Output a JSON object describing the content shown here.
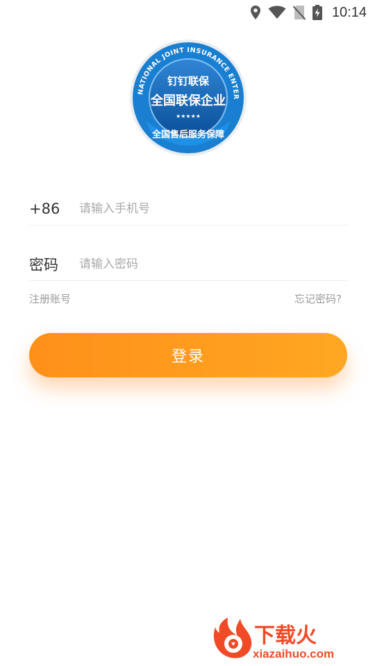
{
  "status_bar": {
    "time": "10:14",
    "icons": [
      "location-icon",
      "wifi-icon",
      "no-sim-icon",
      "battery-charging-icon"
    ]
  },
  "logo": {
    "ring_text": "NATIONAL JOINT INSURANCE ENTERPRISES",
    "brand": "钉钉联保",
    "title": "全国联保企业",
    "stars": "★★★★★",
    "bottom_text": "全国售后服务保障",
    "colors": {
      "outer": "#1a7fd0",
      "inner": "#0d5fae",
      "ribbon": "#1e90e6"
    }
  },
  "form": {
    "phone": {
      "prefix": "+86",
      "value": "",
      "placeholder": "请输入手机号"
    },
    "password": {
      "label": "密码",
      "value": "",
      "placeholder": "请输入密码"
    }
  },
  "links": {
    "register": "注册账号",
    "forgot": "忘记密码?"
  },
  "login_button": {
    "label": "登录",
    "color_start": "#ff901a",
    "color_end": "#ffa722"
  },
  "watermark": {
    "brand": "下载火",
    "domain": "xiazaihuo.com"
  }
}
